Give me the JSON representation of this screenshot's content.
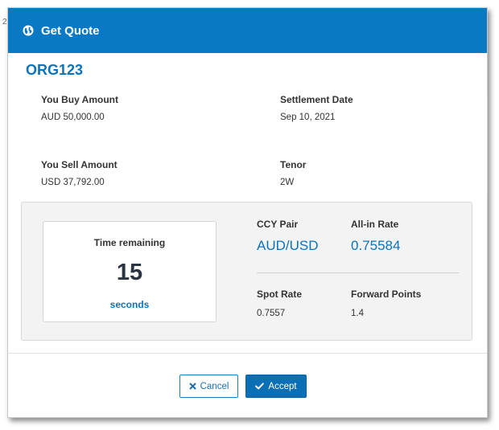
{
  "stray_text": "2",
  "modal": {
    "title": "Get Quote",
    "icon": "globe-icon",
    "header_color": "#0979c5"
  },
  "quote": {
    "org": "ORG123",
    "buy_label": "You Buy Amount",
    "buy_value": "AUD 50,000.00",
    "settle_label": "Settlement Date",
    "settle_value": "Sep 10, 2021",
    "sell_label": "You Sell Amount",
    "sell_value": "USD 37,792.00",
    "tenor_label": "Tenor",
    "tenor_value": "2W"
  },
  "timer": {
    "label": "Time remaining",
    "value": "15",
    "unit": "seconds"
  },
  "rates": {
    "pair_label": "CCY Pair",
    "pair_value": "AUD/USD",
    "allin_label": "All-in Rate",
    "allin_value": "0.75584",
    "spot_label": "Spot Rate",
    "spot_value": "0.7557",
    "fwd_label": "Forward Points",
    "fwd_value": "1.4"
  },
  "actions": {
    "cancel_label": "Cancel",
    "cancel_icon": "close-icon",
    "accept_label": "Accept",
    "accept_icon": "check-icon"
  },
  "colors": {
    "accent": "#0b73bb",
    "panel_bg": "#f3f3f3"
  }
}
